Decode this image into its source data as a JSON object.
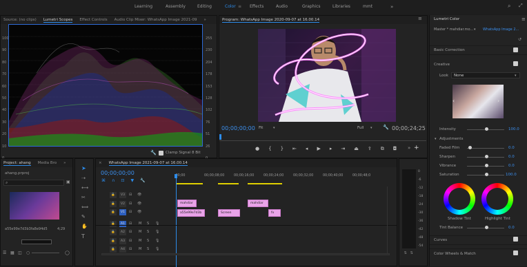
{
  "workspaces": [
    "Learning",
    "Assembly",
    "Editing",
    "Color",
    "Effects",
    "Audio",
    "Graphics",
    "Libraries",
    "mmt"
  ],
  "active_workspace": "Color",
  "source_tabs": {
    "source": "Source: (no clips)",
    "lumetri": "Lumetri Scopes",
    "effect": "Effect Controls",
    "audio": "Audio Clip Mixer: WhatsApp Image 2021-09"
  },
  "scope_left_ticks": [
    "100",
    "90",
    "80",
    "70",
    "60",
    "50",
    "40",
    "30",
    "20",
    "10",
    "0"
  ],
  "scope_right_ticks": [
    "255",
    "230",
    "204",
    "178",
    "153",
    "128",
    "102",
    "76",
    "51",
    "26",
    "0"
  ],
  "scope_footer": {
    "clamp": "Clamp Signal",
    "bits": "8 Bit"
  },
  "program": {
    "title": "Program: WhatsApp Image 2020-09-07 at 16.00.14",
    "timecode": "00;00;00;00",
    "fit": "Fit",
    "quality": "Full",
    "duration": "00;00;24;25"
  },
  "lumetri": {
    "title": "Lumetri Color",
    "master": "Master * mahdiar.mo...",
    "clip": "WhatsApp Image 2...",
    "basic": "Basic Correction",
    "creative": "Creative",
    "look_label": "Look",
    "look_value": "None",
    "intensity_label": "Intensity",
    "intensity_value": "100.0",
    "adjustments": "Adjustments",
    "faded_label": "Faded Film",
    "faded_value": "0.0",
    "sharpen_label": "Sharpen",
    "sharpen_value": "0.0",
    "vibrance_label": "Vibrance",
    "vibrance_value": "0.0",
    "saturation_label": "Saturation",
    "saturation_value": "100.0",
    "shadow_tint": "Shadow Tint",
    "highlight_tint": "Highlight Tint",
    "tint_balance_label": "Tint Balance",
    "tint_balance_value": "0.0",
    "curves": "Curves",
    "color_wheels": "Color Wheels & Match"
  },
  "project": {
    "tab": "Project: ahang",
    "media": "Media Bro",
    "file": "ahang.prproj",
    "clip_name": "a55e99e7d3b3fa8e94d5",
    "clip_dur": "4;29"
  },
  "timeline": {
    "tab": "WhatsApp Image 2021-09-07 at 16.00.14",
    "timecode": "00;00;00;00",
    "ruler": [
      ";00;00",
      "00;00;08;00",
      "00;00;16;00",
      "00;00;24;00",
      "00;00;32;00",
      "00;00;40;00",
      "00;00;48;0"
    ],
    "tracks": [
      "V3",
      "V2",
      "V1",
      "A1",
      "A2",
      "A3",
      "A4"
    ],
    "clips": {
      "v3": "mahdiar",
      "v2": "mahdiar",
      "v1a": "a55e99e7d3b",
      "v1b": "Screen",
      "v1c": "fx"
    }
  },
  "meter_ticks": [
    "0",
    "-6",
    "-12",
    "-18",
    "-24",
    "-30",
    "-36",
    "-42",
    "-48",
    "-54"
  ],
  "meter_labels": {
    "s1": "S",
    "s2": "S"
  }
}
